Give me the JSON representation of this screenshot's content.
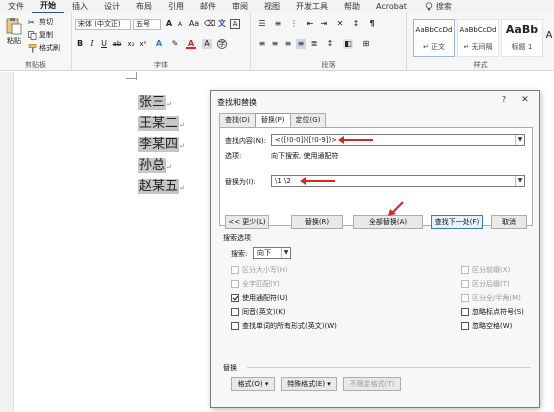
{
  "menu": {
    "tabs": [
      "文件",
      "开始",
      "插入",
      "设计",
      "布局",
      "引用",
      "邮件",
      "审阅",
      "视图",
      "开发工具",
      "帮助",
      "Acrobat"
    ],
    "active_tab": "开始",
    "search_label": "搜索"
  },
  "ribbon": {
    "clipboard": {
      "paste": "粘贴",
      "cut": "剪切",
      "copy": "复制",
      "format_painter": "格式刷",
      "group_label": "剪贴板"
    },
    "font": {
      "font_name": "宋体 (中文正)",
      "font_size": "五号",
      "bold": "B",
      "italic": "I",
      "underline": "U",
      "aa_grow": "A",
      "aa_shrink": "A",
      "change_case": "Aa",
      "group_label": "字体"
    },
    "paragraph": {
      "group_label": "段落"
    },
    "styles": {
      "items": [
        {
          "sample": "AaBbCcDd",
          "name": "↵ 正文"
        },
        {
          "sample": "AaBbCcDd",
          "name": "↵ 无间隔"
        },
        {
          "sample": "AaBb",
          "name": "标题 1"
        }
      ],
      "more": "A",
      "group_label": "样式"
    }
  },
  "document": {
    "lines": [
      "张三",
      "王某二",
      "李某四",
      "孙总",
      "赵某五"
    ],
    "para_mark": "↵"
  },
  "dialog": {
    "title": "查找和替换",
    "help": "?",
    "close": "✕",
    "tabs": [
      "查找(D)",
      "替换(P)",
      "定位(G)"
    ],
    "active_tab": "替换(P)",
    "find_label": "查找内容(N):",
    "find_value": "<([!0-0])([!0-9])>",
    "options_label": "选项:",
    "options_value": "向下搜索, 使用通配符",
    "replace_label": "替换为(I):",
    "replace_value": "\\1  \\2",
    "buttons": {
      "less": "<< 更少(L)",
      "replace": "替换(R)",
      "replace_all": "全部替换(A)",
      "find_next": "查找下一处(F)",
      "cancel": "取消"
    },
    "search_options": {
      "section_label": "搜索选项",
      "search_label": "搜索:",
      "search_value": "向下",
      "left": [
        {
          "label": "区分大小写(H)",
          "checked": false,
          "disabled": true
        },
        {
          "label": "全字匹配(Y)",
          "checked": false,
          "disabled": true
        },
        {
          "label": "使用通配符(U)",
          "checked": true,
          "disabled": false
        },
        {
          "label": "同音(英文)(K)",
          "checked": false,
          "disabled": false
        },
        {
          "label": "查找单词的所有形式(英文)(W)",
          "checked": false,
          "disabled": false
        }
      ],
      "right": [
        {
          "label": "区分前缀(X)",
          "checked": false,
          "disabled": true
        },
        {
          "label": "区分后缀(T)",
          "checked": false,
          "disabled": true
        },
        {
          "label": "区分全/半角(M)",
          "checked": false,
          "disabled": true
        },
        {
          "label": "忽略标点符号(S)",
          "checked": false,
          "disabled": false
        },
        {
          "label": "忽略空格(W)",
          "checked": false,
          "disabled": false
        }
      ]
    },
    "replace_section": {
      "label": "替换",
      "format_button": "格式(O) ▾",
      "special_button": "特殊格式(E) ▾",
      "no_format_button": "不限定格式(T)"
    }
  },
  "colors": {
    "accent": "#2b579a",
    "arrow": "#d9271e",
    "selection": "#c6c6c6"
  }
}
